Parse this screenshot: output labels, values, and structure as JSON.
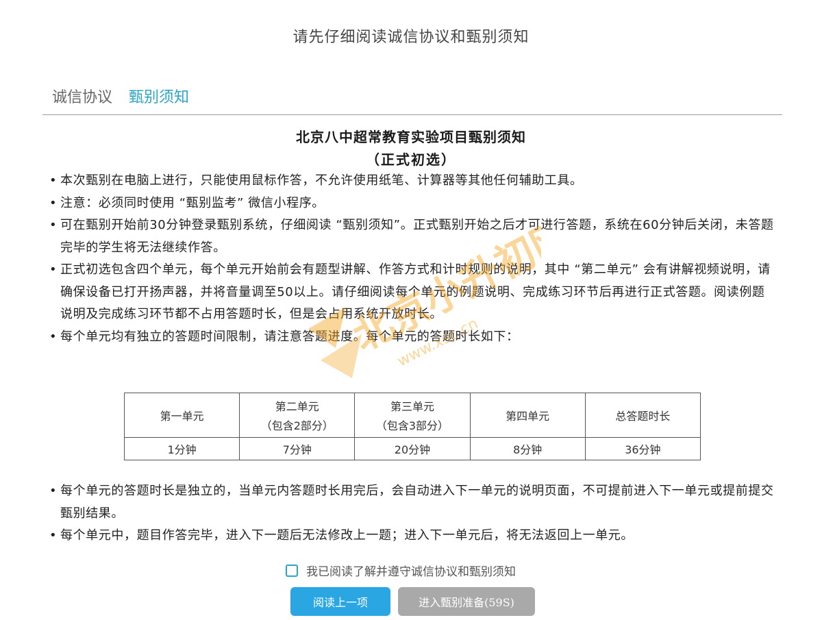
{
  "header": {
    "title": "请先仔细阅读诚信协议和甄别须知"
  },
  "tabs": [
    {
      "label": "诚信协议",
      "active": false
    },
    {
      "label": "甄别须知",
      "active": true
    }
  ],
  "notice": {
    "title": "北京八中超常教育实验项目甄别须知",
    "subtitle": "（正式初选）",
    "bullet": "•",
    "rules_before_table": [
      "本次甄别在电脑上进行，只能使用鼠标作答，不允许使用纸笔、计算器等其他任何辅助工具。",
      "注意：必须同时使用 “甄别监考” 微信小程序。",
      "可在甄别开始前30分钟登录甄别系统，仔细阅读 “甄别须知”。正式甄别开始之后才可进行答题，系统在60分钟后关闭，未答题完毕的学生将无法继续作答。",
      "正式初选包含四个单元，每个单元开始前会有题型讲解、作答方式和计时规则的说明，其中 “第二单元” 会有讲解视频说明，请确保设备已打开扬声器，并将音量调至50以上。请仔细阅读每个单元的例题说明、完成练习环节后再进行正式答题。阅读例题说明及完成练习环节都不占用答题时长，但是会占用系统开放时长。",
      "每个单元均有独立的答题时间限制，请注意答题进度。每个单元的答题时长如下："
    ],
    "rules_after_table": [
      "每个单元的答题时长是独立的，当单元内答题时长用完后，会自动进入下一单元的说明页面，不可提前进入下一单元或提前提交甄别结果。",
      "每个单元中，题目作答完毕，进入下一题后无法修改上一题；进入下一单元后，将无法返回上一单元。"
    ]
  },
  "timing_table": {
    "headers": [
      {
        "main": "第一单元",
        "sub": ""
      },
      {
        "main": "第二单元",
        "sub": "（包含2部分）"
      },
      {
        "main": "第三单元",
        "sub": "（包含3部分）"
      },
      {
        "main": "第四单元",
        "sub": ""
      },
      {
        "main": "总答题时长",
        "sub": ""
      }
    ],
    "values": [
      "1分钟",
      "7分钟",
      "20分钟",
      "8分钟",
      "36分钟"
    ]
  },
  "agreement": {
    "label": "我已阅读了解并遵守诚信协议和甄别须知",
    "checked": false
  },
  "buttons": {
    "prev_label": "阅读上一项",
    "next_label": "进入甄别准备(59S)"
  },
  "watermark": {
    "text": "北京小升初网",
    "url": "www.xsc.cn"
  },
  "colors": {
    "accent": "#2aa6c9",
    "primary_button": "#2aa6e3",
    "disabled_button": "#a9a9a9",
    "watermark": "#f5a623"
  }
}
